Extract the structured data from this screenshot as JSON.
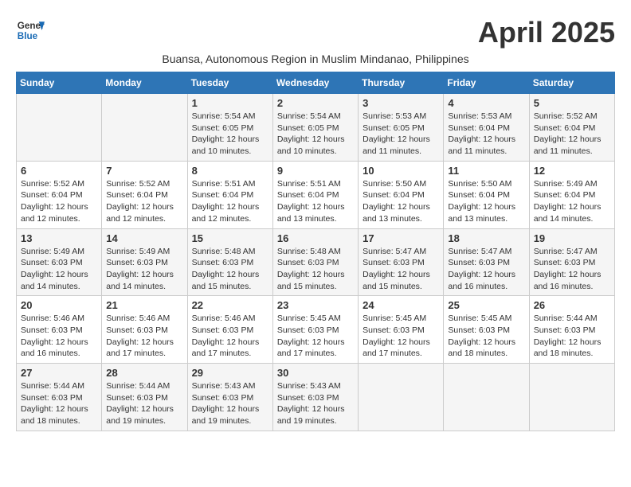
{
  "header": {
    "logo_line1": "General",
    "logo_line2": "Blue",
    "month_title": "April 2025",
    "subtitle": "Buansa, Autonomous Region in Muslim Mindanao, Philippines"
  },
  "weekdays": [
    "Sunday",
    "Monday",
    "Tuesday",
    "Wednesday",
    "Thursday",
    "Friday",
    "Saturday"
  ],
  "weeks": [
    [
      {
        "day": "",
        "info": ""
      },
      {
        "day": "",
        "info": ""
      },
      {
        "day": "1",
        "info": "Sunrise: 5:54 AM\nSunset: 6:05 PM\nDaylight: 12 hours\nand 10 minutes."
      },
      {
        "day": "2",
        "info": "Sunrise: 5:54 AM\nSunset: 6:05 PM\nDaylight: 12 hours\nand 10 minutes."
      },
      {
        "day": "3",
        "info": "Sunrise: 5:53 AM\nSunset: 6:05 PM\nDaylight: 12 hours\nand 11 minutes."
      },
      {
        "day": "4",
        "info": "Sunrise: 5:53 AM\nSunset: 6:04 PM\nDaylight: 12 hours\nand 11 minutes."
      },
      {
        "day": "5",
        "info": "Sunrise: 5:52 AM\nSunset: 6:04 PM\nDaylight: 12 hours\nand 11 minutes."
      }
    ],
    [
      {
        "day": "6",
        "info": "Sunrise: 5:52 AM\nSunset: 6:04 PM\nDaylight: 12 hours\nand 12 minutes."
      },
      {
        "day": "7",
        "info": "Sunrise: 5:52 AM\nSunset: 6:04 PM\nDaylight: 12 hours\nand 12 minutes."
      },
      {
        "day": "8",
        "info": "Sunrise: 5:51 AM\nSunset: 6:04 PM\nDaylight: 12 hours\nand 12 minutes."
      },
      {
        "day": "9",
        "info": "Sunrise: 5:51 AM\nSunset: 6:04 PM\nDaylight: 12 hours\nand 13 minutes."
      },
      {
        "day": "10",
        "info": "Sunrise: 5:50 AM\nSunset: 6:04 PM\nDaylight: 12 hours\nand 13 minutes."
      },
      {
        "day": "11",
        "info": "Sunrise: 5:50 AM\nSunset: 6:04 PM\nDaylight: 12 hours\nand 13 minutes."
      },
      {
        "day": "12",
        "info": "Sunrise: 5:49 AM\nSunset: 6:04 PM\nDaylight: 12 hours\nand 14 minutes."
      }
    ],
    [
      {
        "day": "13",
        "info": "Sunrise: 5:49 AM\nSunset: 6:03 PM\nDaylight: 12 hours\nand 14 minutes."
      },
      {
        "day": "14",
        "info": "Sunrise: 5:49 AM\nSunset: 6:03 PM\nDaylight: 12 hours\nand 14 minutes."
      },
      {
        "day": "15",
        "info": "Sunrise: 5:48 AM\nSunset: 6:03 PM\nDaylight: 12 hours\nand 15 minutes."
      },
      {
        "day": "16",
        "info": "Sunrise: 5:48 AM\nSunset: 6:03 PM\nDaylight: 12 hours\nand 15 minutes."
      },
      {
        "day": "17",
        "info": "Sunrise: 5:47 AM\nSunset: 6:03 PM\nDaylight: 12 hours\nand 15 minutes."
      },
      {
        "day": "18",
        "info": "Sunrise: 5:47 AM\nSunset: 6:03 PM\nDaylight: 12 hours\nand 16 minutes."
      },
      {
        "day": "19",
        "info": "Sunrise: 5:47 AM\nSunset: 6:03 PM\nDaylight: 12 hours\nand 16 minutes."
      }
    ],
    [
      {
        "day": "20",
        "info": "Sunrise: 5:46 AM\nSunset: 6:03 PM\nDaylight: 12 hours\nand 16 minutes."
      },
      {
        "day": "21",
        "info": "Sunrise: 5:46 AM\nSunset: 6:03 PM\nDaylight: 12 hours\nand 17 minutes."
      },
      {
        "day": "22",
        "info": "Sunrise: 5:46 AM\nSunset: 6:03 PM\nDaylight: 12 hours\nand 17 minutes."
      },
      {
        "day": "23",
        "info": "Sunrise: 5:45 AM\nSunset: 6:03 PM\nDaylight: 12 hours\nand 17 minutes."
      },
      {
        "day": "24",
        "info": "Sunrise: 5:45 AM\nSunset: 6:03 PM\nDaylight: 12 hours\nand 17 minutes."
      },
      {
        "day": "25",
        "info": "Sunrise: 5:45 AM\nSunset: 6:03 PM\nDaylight: 12 hours\nand 18 minutes."
      },
      {
        "day": "26",
        "info": "Sunrise: 5:44 AM\nSunset: 6:03 PM\nDaylight: 12 hours\nand 18 minutes."
      }
    ],
    [
      {
        "day": "27",
        "info": "Sunrise: 5:44 AM\nSunset: 6:03 PM\nDaylight: 12 hours\nand 18 minutes."
      },
      {
        "day": "28",
        "info": "Sunrise: 5:44 AM\nSunset: 6:03 PM\nDaylight: 12 hours\nand 19 minutes."
      },
      {
        "day": "29",
        "info": "Sunrise: 5:43 AM\nSunset: 6:03 PM\nDaylight: 12 hours\nand 19 minutes."
      },
      {
        "day": "30",
        "info": "Sunrise: 5:43 AM\nSunset: 6:03 PM\nDaylight: 12 hours\nand 19 minutes."
      },
      {
        "day": "",
        "info": ""
      },
      {
        "day": "",
        "info": ""
      },
      {
        "day": "",
        "info": ""
      }
    ]
  ]
}
